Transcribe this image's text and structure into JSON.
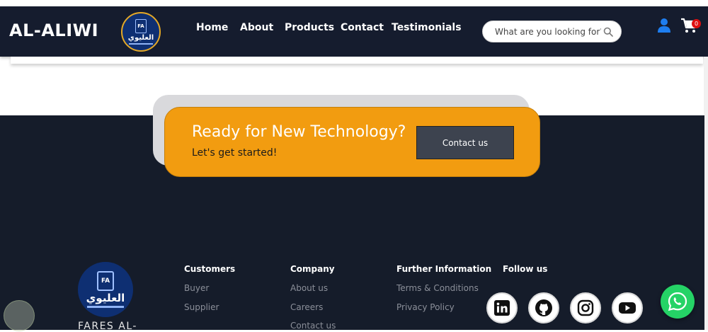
{
  "header": {
    "brand": "AL-ALIWI",
    "logo": {
      "initials": "FA",
      "arabic": "العليوي"
    },
    "nav": [
      "Home",
      "About",
      "Products",
      "Contact",
      "Testimonials"
    ],
    "search": {
      "placeholder": "What are you looking for?",
      "icon": "search-icon"
    },
    "account_icon": "user-icon",
    "cart": {
      "icon": "cart-icon",
      "count": "0"
    }
  },
  "cta": {
    "title": "Ready for New Technology?",
    "subtitle": "Let's get started!",
    "button_label": "Contact us"
  },
  "footer": {
    "logo": {
      "initials": "FA",
      "arabic": "العليوي"
    },
    "company_name": "FARES AL-",
    "columns": [
      {
        "heading": "Customers",
        "links": [
          "Buyer",
          "Supplier"
        ]
      },
      {
        "heading": "Company",
        "links": [
          "About us",
          "Careers",
          "Contact us"
        ]
      },
      {
        "heading": "Further Information",
        "links": [
          "Terms & Conditions",
          "Privacy Policy"
        ]
      },
      {
        "heading": "Follow us",
        "links": []
      }
    ],
    "social": [
      "linkedin-icon",
      "github-icon",
      "instagram-icon",
      "youtube-icon"
    ]
  },
  "colors": {
    "navbar": "#151c2e",
    "footer": "#151c2a",
    "cta": "#f29c10",
    "cta_button": "#3d434f",
    "whatsapp": "#25d366",
    "accent_user": "#1e7ef0"
  },
  "floating": {
    "whatsapp_icon": "whatsapp-icon"
  }
}
